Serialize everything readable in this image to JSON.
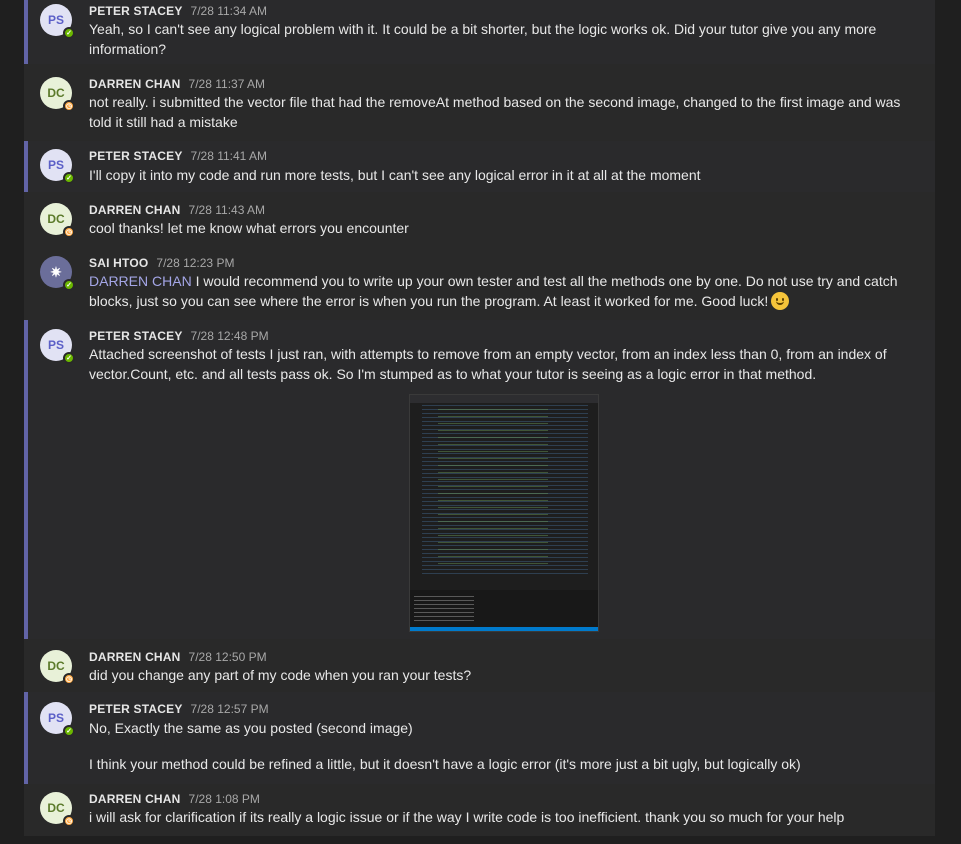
{
  "messages": [
    {
      "initials": "PS",
      "name": "PETER STACEY",
      "time": "7/28 11:34 AM",
      "status": "available",
      "lines": [
        "Yeah, so I can't see any logical problem with it. It could be a bit shorter, but the logic works ok. Did your tutor give you any more information?"
      ]
    },
    {
      "initials": "DC",
      "name": "DARREN CHAN",
      "time": "7/28 11:37 AM",
      "status": "away",
      "lines": [
        "not really. i submitted the vector file that had the removeAt method based on the second image, changed to the first image and was told it still had a mistake"
      ]
    },
    {
      "initials": "PS",
      "name": "PETER STACEY",
      "time": "7/28 11:41 AM",
      "status": "available",
      "lines": [
        "I'll copy it into my code and run more tests, but I can't see any logical error in it at all at the moment"
      ]
    },
    {
      "initials": "DC",
      "name": "DARREN CHAN",
      "time": "7/28 11:43 AM",
      "status": "away",
      "lines": [
        "cool thanks! let me know what errors you encounter"
      ]
    },
    {
      "name": "SAI HTOO",
      "time": "7/28 12:23 PM",
      "status": "available",
      "mention": "DARREN CHAN",
      "lines": [
        "I would recommend you to write up your own tester and test all the methods one by one. Do not use try and catch blocks, just so you can see where the error is when you run the program. At least it worked for me. Good luck!"
      ],
      "emoji": "smile-emoji"
    },
    {
      "initials": "PS",
      "name": "PETER STACEY",
      "time": "7/28 12:48 PM",
      "status": "available",
      "lines": [
        "Attached screenshot of tests I just ran, with attempts to remove from an empty vector, from an index less than 0, from an index of vector.Count, etc. and all tests pass ok. So I'm stumped as to what your tutor is seeing as a logic error in that method."
      ],
      "attachment": "code-screenshot-image"
    },
    {
      "initials": "DC",
      "name": "DARREN CHAN",
      "time": "7/28 12:50 PM",
      "status": "away",
      "lines": [
        "did you change any part of my code when you ran your tests?"
      ]
    },
    {
      "initials": "PS",
      "name": "PETER STACEY",
      "time": "7/28 12:57 PM",
      "status": "available",
      "lines": [
        "No, Exactly the same as you posted (second image)",
        "I think your method could be refined a little, but it doesn't have a logic error (it's more just a bit ugly, but logically ok)"
      ]
    },
    {
      "initials": "DC",
      "name": "DARREN CHAN",
      "time": "7/28 1:08 PM",
      "status": "away",
      "lines": [
        "i will ask for clarification if its really a logic issue or if the way I write code is too inefficient. thank you so much for your help"
      ]
    }
  ],
  "colors": {
    "accent": "#6264a7",
    "available": "#6bb700",
    "away": "#ffaa44",
    "mention": "#a4a6e6"
  }
}
